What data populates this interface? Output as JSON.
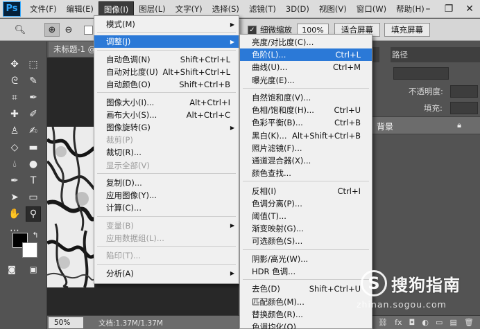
{
  "app": {
    "logo": "Ps"
  },
  "menubar": {
    "items": [
      "文件(F)",
      "编辑(E)",
      "图像(I)",
      "图层(L)",
      "文字(Y)",
      "选择(S)",
      "滤镜(T)",
      "3D(D)",
      "视图(V)",
      "窗口(W)",
      "帮助(H)"
    ],
    "active_index": 2,
    "window_controls": [
      "–",
      "❐",
      "✕"
    ]
  },
  "options": {
    "fine_zoom_label": "细微缩放",
    "zoom_value": "100%",
    "fit_screen_label": "适合屏幕",
    "fill_screen_label": "填充屏幕"
  },
  "document": {
    "tab_title": "未标题-1 @",
    "zoom": "50%",
    "size": "文档:1.37M/1.37M"
  },
  "image_menu": {
    "items": [
      {
        "label": "模式(M)",
        "shortcut": "",
        "submenu": true,
        "disabled": false
      },
      {
        "sep": true
      },
      {
        "label": "调整(J)",
        "shortcut": "",
        "submenu": true,
        "disabled": false,
        "highlight": true
      },
      {
        "sep": true
      },
      {
        "label": "自动色调(N)",
        "shortcut": "Shift+Ctrl+L",
        "disabled": false
      },
      {
        "label": "自动对比度(U)",
        "shortcut": "Alt+Shift+Ctrl+L",
        "disabled": false
      },
      {
        "label": "自动颜色(O)",
        "shortcut": "Shift+Ctrl+B",
        "disabled": false
      },
      {
        "sep": true
      },
      {
        "label": "图像大小(I)...",
        "shortcut": "Alt+Ctrl+I",
        "disabled": false
      },
      {
        "label": "画布大小(S)...",
        "shortcut": "Alt+Ctrl+C",
        "disabled": false
      },
      {
        "label": "图像旋转(G)",
        "shortcut": "",
        "submenu": true,
        "disabled": false
      },
      {
        "label": "裁剪(P)",
        "shortcut": "",
        "disabled": true
      },
      {
        "label": "裁切(R)...",
        "shortcut": "",
        "disabled": false
      },
      {
        "label": "显示全部(V)",
        "shortcut": "",
        "disabled": true
      },
      {
        "sep": true
      },
      {
        "label": "复制(D)...",
        "shortcut": "",
        "disabled": false
      },
      {
        "label": "应用图像(Y)...",
        "shortcut": "",
        "disabled": false
      },
      {
        "label": "计算(C)...",
        "shortcut": "",
        "disabled": false
      },
      {
        "sep": true
      },
      {
        "label": "变量(B)",
        "shortcut": "",
        "submenu": true,
        "disabled": true
      },
      {
        "label": "应用数据组(L)...",
        "shortcut": "",
        "disabled": true
      },
      {
        "sep": true
      },
      {
        "label": "陷印(T)...",
        "shortcut": "",
        "disabled": true
      },
      {
        "sep": true
      },
      {
        "label": "分析(A)",
        "shortcut": "",
        "submenu": true,
        "disabled": false
      }
    ]
  },
  "adjust_menu": {
    "items": [
      {
        "label": "亮度/对比度(C)...",
        "shortcut": ""
      },
      {
        "label": "色阶(L)...",
        "shortcut": "Ctrl+L",
        "highlight": true
      },
      {
        "label": "曲线(U)...",
        "shortcut": "Ctrl+M"
      },
      {
        "label": "曝光度(E)...",
        "shortcut": ""
      },
      {
        "sep": true
      },
      {
        "label": "自然饱和度(V)...",
        "shortcut": ""
      },
      {
        "label": "色相/饱和度(H)...",
        "shortcut": "Ctrl+U"
      },
      {
        "label": "色彩平衡(B)...",
        "shortcut": "Ctrl+B"
      },
      {
        "label": "黑白(K)...",
        "shortcut": "Alt+Shift+Ctrl+B"
      },
      {
        "label": "照片滤镜(F)...",
        "shortcut": ""
      },
      {
        "label": "通道混合器(X)...",
        "shortcut": ""
      },
      {
        "label": "颜色查找...",
        "shortcut": ""
      },
      {
        "sep": true
      },
      {
        "label": "反相(I)",
        "shortcut": "Ctrl+I"
      },
      {
        "label": "色调分离(P)...",
        "shortcut": ""
      },
      {
        "label": "阈值(T)...",
        "shortcut": ""
      },
      {
        "label": "渐变映射(G)...",
        "shortcut": ""
      },
      {
        "label": "可选颜色(S)...",
        "shortcut": ""
      },
      {
        "sep": true
      },
      {
        "label": "阴影/高光(W)...",
        "shortcut": ""
      },
      {
        "label": "HDR 色调...",
        "shortcut": ""
      },
      {
        "sep": true
      },
      {
        "label": "去色(D)",
        "shortcut": "Shift+Ctrl+U"
      },
      {
        "label": "匹配颜色(M)...",
        "shortcut": ""
      },
      {
        "label": "替换颜色(R)...",
        "shortcut": ""
      },
      {
        "label": "色调均化(Q)",
        "shortcut": ""
      }
    ]
  },
  "panels": {
    "paths_tab": "路径",
    "opacity_label": "不透明度:",
    "fill_label": "填充:",
    "layer_name": "背景"
  },
  "watermark": {
    "text": "搜狗指南",
    "url": "zhinan.sogou.com"
  },
  "colors": {
    "menu_highlight": "#2b79d7",
    "menu_bg": "#f0f0f0",
    "workspace": "#535353"
  }
}
